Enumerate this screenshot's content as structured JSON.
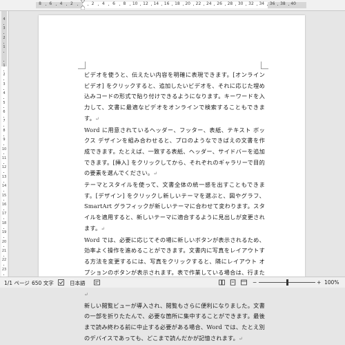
{
  "ruler": {
    "h_labels": [
      "8",
      "6",
      "4",
      "2",
      "",
      "2",
      "4",
      "6",
      "8",
      "10",
      "12",
      "14",
      "16",
      "18",
      "20",
      "22",
      "24",
      "26",
      "28",
      "30",
      "32",
      "34",
      "36",
      "38",
      "40"
    ],
    "v_labels": [
      "4",
      "3",
      "2",
      "1",
      "",
      "1",
      "2",
      "3",
      "4",
      "5",
      "6",
      "7",
      "8",
      "9",
      "10",
      "11",
      "12",
      "13",
      "14",
      "15",
      "16",
      "17",
      "18",
      "19",
      "20",
      "21",
      "22",
      "23"
    ]
  },
  "document": {
    "paragraphs": [
      "ビデオを使うと、伝えたい内容を明確に表現できます。[オンライン ビデオ] をクリックすると、追加したいビデオを、それに応じた埋め込みコードの形式で貼り付けできるようになります。キーワードを入力して、文書に最適なビデオをオンラインで検索することもできます。",
      "Word に用意されているヘッダー、フッター、表紙、テキスト ボックス デザインを組み合わせると、プロのようなできばえの文書を作成できます。たとえば、一致する表紙、ヘッダー、サイドバーを追加できます。[挿入] をクリックしてから、それぞれのギャラリーで目的の要素を選んでください。",
      "テーマとスタイルを使って、文書全体の統一感を出すこともできます。[デザイン] をクリックし新しいテーマを選ぶと、図やグラフ、SmartArt グラフィックが新しいテーマに合わせて変わります。スタイルを適用すると、新しいテーマに適合するように見出しが変更されます。",
      "Word では、必要に応じてその場に新しいボタンが表示されるため、効率よく操作を進めることができます。文書内に写真をレイアウトする方法を変更するには、写真をクリックすると、隣にレイアウト オプションのボタンが表示されます。表で作業している場合は、行または列を追加する場所をクリックして、プラス記号をクリックします。",
      "新しい閲覧ビューが導入され、閲覧もさらに便利になりました。文書の一部を折りたたんで、必要な箇所に集中することができます。最後まで読み終わる前に中止する必要がある場合、Word では、たとえ別のデバイスであっても、どこまで読んだかが記憶されます。"
    ],
    "paragraph_mark": "↵"
  },
  "statusbar": {
    "page": "1/1 ページ",
    "words": "650 文字",
    "language": "日本語",
    "zoom_minus": "−",
    "zoom_plus": "+",
    "zoom": "100%",
    "zoom_level": 1.0
  },
  "icons": {
    "proofing": "proofing-icon",
    "macro": "macro-record-icon",
    "read_mode": "read-mode-icon",
    "print_layout": "print-layout-icon",
    "web_layout": "web-layout-icon"
  }
}
